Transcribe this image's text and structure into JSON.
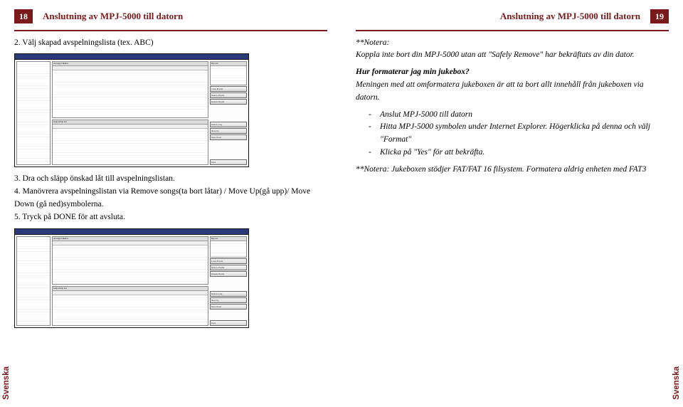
{
  "left": {
    "page_no": "18",
    "header": "Anslutning av MPJ-5000 till datorn",
    "step2": "2. Välj skapad avspelningslista (tex. ABC)",
    "step3": "3. Dra och släpp önskad låt till avspelningslistan.",
    "step4": "4. Manövrera avspelningslistan via Remove songs(ta bort låtar) / Move Up(gå upp)/ Move Down (gå ned)symbolerna.",
    "step5": "5. Tryck på DONE för att avsluta.",
    "side": "Svenska",
    "shot": {
      "topGridLabel": "All song in Jukebox",
      "playlistLabel": "Play List",
      "songsLabel": "Songs in Play List",
      "btnCreate": "Create Playlist",
      "btnRemovePl": "Remove Playlist",
      "btnRenamePl": "Rename Playlist",
      "btnRemoveSong": "Remove song",
      "btnMoveUp": "Move Up",
      "btnMoveDown": "Move Down",
      "btnDone": "Done"
    }
  },
  "right": {
    "page_no": "19",
    "header": "Anslutning av MPJ-5000 till datorn",
    "note_head": "**Notera:",
    "note_body": "Koppla inte bort din MPJ-5000 utan att \"Safely Remove\" har bekräftats av din dator.",
    "q": "Hur formaterar jag min jukebox?",
    "q_body": "Meningen med att omformatera jukeboxen är att ta bort allt innehåll från jukeboxen via datorn.",
    "bullets": {
      "b1": "Anslut MPJ-5000 till datorn",
      "b2": "Hitta MPJ-5000 symbolen under Internet Explorer. Högerklicka på denna och välj \"Format\"",
      "b3": "Klicka på \"Yes\" för att bekräfta."
    },
    "note2": "**Notera: Jukeboxen stödjer FAT/FAT 16 filsystem. Formatera aldrig enheten med FAT3",
    "side": "Svenska"
  }
}
